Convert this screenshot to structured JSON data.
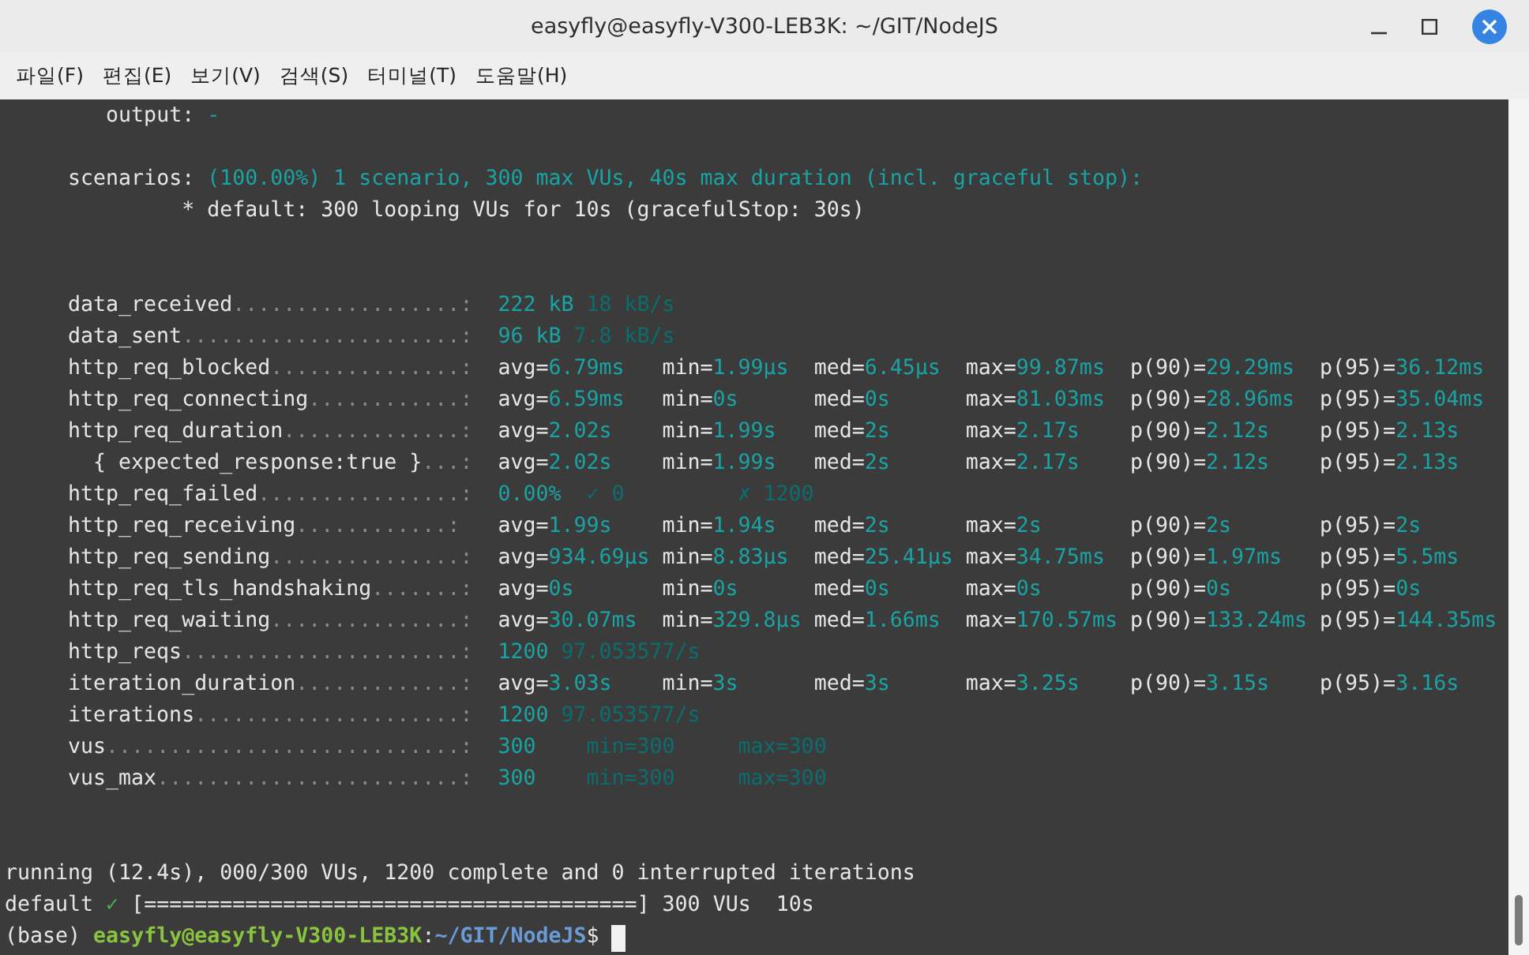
{
  "window": {
    "title": "easyfly@easyfly-V300-LEB3K: ~/GIT/NodeJS"
  },
  "menu": [
    "파일(F)",
    "편집(E)",
    "보기(V)",
    "검색(S)",
    "터미널(T)",
    "도움말(H)"
  ],
  "terminal": {
    "lines": [
      {
        "kind": "text",
        "segments": [
          {
            "text": "        output: ",
            "kind": "label"
          },
          {
            "text": "-",
            "kind": "value"
          }
        ]
      },
      {
        "kind": "blank"
      },
      {
        "kind": "text",
        "segments": [
          {
            "text": "     scenarios: ",
            "kind": "label"
          },
          {
            "text": "(100.00%) 1 scenario, 300 max VUs, 40s max duration (incl. graceful stop):",
            "kind": "value"
          }
        ]
      },
      {
        "kind": "text",
        "segments": [
          {
            "text": "              * default: 300 looping VUs for 10s (gracefulStop: 30s)",
            "kind": "label"
          }
        ]
      },
      {
        "kind": "blank"
      },
      {
        "kind": "blank"
      },
      {
        "kind": "counts",
        "name": "data_received",
        "dots": "..................:",
        "cells": [
          {
            "text": "222 kB",
            "kind": "value"
          },
          {
            "text": "18 kB/s",
            "kind": "dim"
          }
        ]
      },
      {
        "kind": "counts",
        "name": "data_sent",
        "dots": "......................:",
        "cells": [
          {
            "text": "96 kB",
            "kind": "value"
          },
          {
            "text": "7.8 kB/s",
            "kind": "dim"
          }
        ]
      },
      {
        "kind": "stats",
        "name": "http_req_blocked",
        "dots": "...............:",
        "stats": [
          {
            "label": "avg=",
            "value": "6.79ms"
          },
          {
            "label": "min=",
            "value": "1.99µs"
          },
          {
            "label": "med=",
            "value": "6.45µs"
          },
          {
            "label": "max=",
            "value": "99.87ms"
          },
          {
            "label": "p(90)=",
            "value": "29.29ms"
          },
          {
            "label": "p(95)=",
            "value": "36.12ms"
          }
        ]
      },
      {
        "kind": "stats",
        "name": "http_req_connecting",
        "dots": "............:",
        "stats": [
          {
            "label": "avg=",
            "value": "6.59ms"
          },
          {
            "label": "min=",
            "value": "0s"
          },
          {
            "label": "med=",
            "value": "0s"
          },
          {
            "label": "max=",
            "value": "81.03ms"
          },
          {
            "label": "p(90)=",
            "value": "28.96ms"
          },
          {
            "label": "p(95)=",
            "value": "35.04ms"
          }
        ]
      },
      {
        "kind": "stats",
        "name": "http_req_duration",
        "dots": "..............:",
        "stats": [
          {
            "label": "avg=",
            "value": "2.02s"
          },
          {
            "label": "min=",
            "value": "1.99s"
          },
          {
            "label": "med=",
            "value": "2s"
          },
          {
            "label": "max=",
            "value": "2.17s"
          },
          {
            "label": "p(90)=",
            "value": "2.12s"
          },
          {
            "label": "p(95)=",
            "value": "2.13s"
          }
        ]
      },
      {
        "kind": "stats",
        "name": "  { expected_response:true }",
        "dots": "...:",
        "stats": [
          {
            "label": "avg=",
            "value": "2.02s"
          },
          {
            "label": "min=",
            "value": "1.99s"
          },
          {
            "label": "med=",
            "value": "2s"
          },
          {
            "label": "max=",
            "value": "2.17s"
          },
          {
            "label": "p(90)=",
            "value": "2.12s"
          },
          {
            "label": "p(95)=",
            "value": "2.13s"
          }
        ]
      },
      {
        "kind": "counts",
        "name": "http_req_failed",
        "dots": "................:",
        "cells": [
          {
            "text": "0.00%",
            "kind": "value"
          },
          {
            "text": "✓ 0",
            "kind": "dim"
          },
          {
            "text": "✗ 1200",
            "kind": "dim"
          }
        ]
      },
      {
        "kind": "stats",
        "name": "http_req_receiving",
        "dots": "............:",
        "stats": [
          {
            "label": "avg=",
            "value": "1.99s"
          },
          {
            "label": "min=",
            "value": "1.94s"
          },
          {
            "label": "med=",
            "value": "2s"
          },
          {
            "label": "max=",
            "value": "2s"
          },
          {
            "label": "p(90)=",
            "value": "2s"
          },
          {
            "label": "p(95)=",
            "value": "2s"
          }
        ]
      },
      {
        "kind": "stats",
        "name": "http_req_sending",
        "dots": "...............:",
        "stats": [
          {
            "label": "avg=",
            "value": "934.69µs"
          },
          {
            "label": "min=",
            "value": "8.83µs"
          },
          {
            "label": "med=",
            "value": "25.41µs"
          },
          {
            "label": "max=",
            "value": "34.75ms"
          },
          {
            "label": "p(90)=",
            "value": "1.97ms"
          },
          {
            "label": "p(95)=",
            "value": "5.5ms"
          }
        ]
      },
      {
        "kind": "stats",
        "name": "http_req_tls_handshaking",
        "dots": ".......:",
        "stats": [
          {
            "label": "avg=",
            "value": "0s"
          },
          {
            "label": "min=",
            "value": "0s"
          },
          {
            "label": "med=",
            "value": "0s"
          },
          {
            "label": "max=",
            "value": "0s"
          },
          {
            "label": "p(90)=",
            "value": "0s"
          },
          {
            "label": "p(95)=",
            "value": "0s"
          }
        ]
      },
      {
        "kind": "stats",
        "name": "http_req_waiting",
        "dots": "...............:",
        "stats": [
          {
            "label": "avg=",
            "value": "30.07ms"
          },
          {
            "label": "min=",
            "value": "329.8µs"
          },
          {
            "label": "med=",
            "value": "1.66ms"
          },
          {
            "label": "max=",
            "value": "170.57ms"
          },
          {
            "label": "p(90)=",
            "value": "133.24ms"
          },
          {
            "label": "p(95)=",
            "value": "144.35ms"
          }
        ]
      },
      {
        "kind": "counts",
        "name": "http_reqs",
        "dots": "......................:",
        "cells": [
          {
            "text": "1200",
            "kind": "value"
          },
          {
            "text": "97.053577/s",
            "kind": "dim"
          }
        ]
      },
      {
        "kind": "stats",
        "name": "iteration_duration",
        "dots": ".............:",
        "stats": [
          {
            "label": "avg=",
            "value": "3.03s"
          },
          {
            "label": "min=",
            "value": "3s"
          },
          {
            "label": "med=",
            "value": "3s"
          },
          {
            "label": "max=",
            "value": "3.25s"
          },
          {
            "label": "p(90)=",
            "value": "3.15s"
          },
          {
            "label": "p(95)=",
            "value": "3.16s"
          }
        ]
      },
      {
        "kind": "counts",
        "name": "iterations",
        "dots": ".....................:",
        "cells": [
          {
            "text": "1200",
            "kind": "value"
          },
          {
            "text": "97.053577/s",
            "kind": "dim"
          }
        ]
      },
      {
        "kind": "counts",
        "name": "vus",
        "dots": "............................:",
        "cells": [
          {
            "text": "300",
            "kind": "value"
          },
          {
            "text": "min=300",
            "kind": "dim"
          },
          {
            "text": "max=300",
            "kind": "dim"
          }
        ]
      },
      {
        "kind": "counts",
        "name": "vus_max",
        "dots": "........................:",
        "cells": [
          {
            "text": "300",
            "kind": "value"
          },
          {
            "text": "min=300",
            "kind": "dim"
          },
          {
            "text": "max=300",
            "kind": "dim"
          }
        ]
      },
      {
        "kind": "blank"
      },
      {
        "kind": "blank"
      },
      {
        "kind": "text",
        "segments": [
          {
            "text": "running (12.4s), 000/300 VUs, 1200 complete and 0 interrupted iterations",
            "kind": "label"
          }
        ]
      },
      {
        "kind": "text",
        "segments": [
          {
            "text": "default ",
            "kind": "label"
          },
          {
            "text": "✓",
            "kind": "check"
          },
          {
            "text": " [=======================================] 300 VUs  10s",
            "kind": "label"
          }
        ]
      },
      {
        "kind": "text",
        "cursor": true,
        "segments": [
          {
            "text": "(base) ",
            "kind": "label"
          },
          {
            "text": "easyfly@easyfly-V300-LEB3K",
            "kind": "user"
          },
          {
            "text": ":",
            "kind": "label"
          },
          {
            "text": "~/GIT/NodeJS",
            "kind": "path"
          },
          {
            "text": "$ ",
            "kind": "label"
          }
        ]
      }
    ]
  }
}
